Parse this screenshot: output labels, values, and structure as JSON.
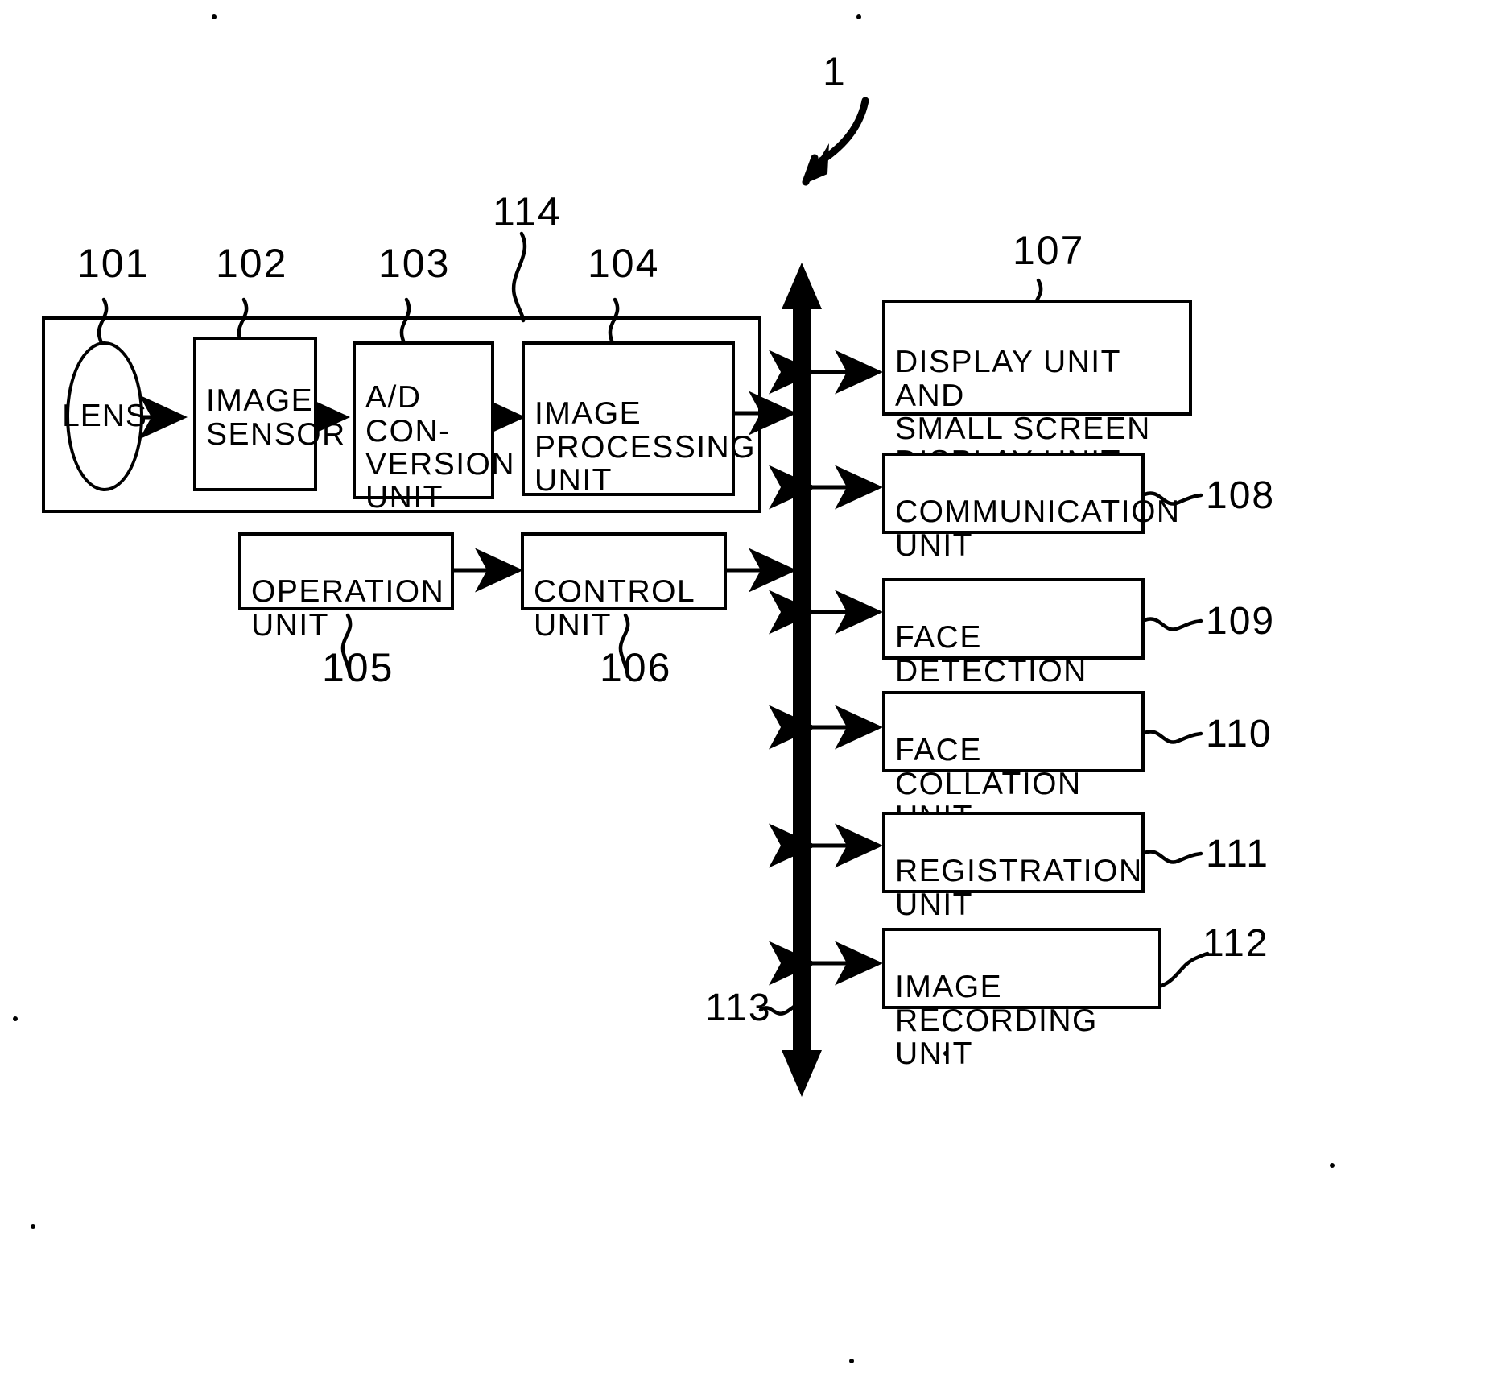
{
  "figure": {
    "overall_ref": "1",
    "blocks": [
      {
        "id": "lens",
        "ref": "101",
        "label": "LENS"
      },
      {
        "id": "image-sensor",
        "ref": "102",
        "label": "IMAGE\nSENSOR"
      },
      {
        "id": "ad-conversion",
        "ref": "103",
        "label": "A/D\nCON-\nVERSION\nUNIT"
      },
      {
        "id": "image-processing",
        "ref": "104",
        "label": "IMAGE\nPROCESSING\nUNIT"
      },
      {
        "id": "operation",
        "ref": "105",
        "label": "OPERATION\nUNIT"
      },
      {
        "id": "control",
        "ref": "106",
        "label": "CONTROL\nUNIT"
      },
      {
        "id": "display",
        "ref": "107",
        "label": "DISPLAY UNIT AND\nSMALL SCREEN\nDISPLAY UNIT"
      },
      {
        "id": "communication",
        "ref": "108",
        "label": "COMMUNICATION\nUNIT"
      },
      {
        "id": "face-detection",
        "ref": "109",
        "label": "FACE DETECTION\nUNIT"
      },
      {
        "id": "face-collation",
        "ref": "110",
        "label": "FACE COLLATION\nUNIT"
      },
      {
        "id": "registration",
        "ref": "111",
        "label": "REGISTRATION\nUNIT"
      },
      {
        "id": "image-recording",
        "ref": "112",
        "label": "IMAGE RECORDING\nUNIT"
      }
    ],
    "bus": {
      "ref": "113",
      "name": "system-bus"
    },
    "imaging_frame": {
      "ref": "114",
      "name": "imaging-unit-enclosure"
    }
  },
  "refs": {
    "r1": "1",
    "r101": "101",
    "r102": "102",
    "r103": "103",
    "r104": "104",
    "r105": "105",
    "r106": "106",
    "r107": "107",
    "r108": "108",
    "r109": "109",
    "r110": "110",
    "r111": "111",
    "r112": "112",
    "r113": "113",
    "r114": "114"
  },
  "labels": {
    "lens": "LENS",
    "image_sensor": "IMAGE\nSENSOR",
    "ad_conversion": "A/D\nCON-\nVERSION\nUNIT",
    "image_processing": "IMAGE\nPROCESSING\nUNIT",
    "operation_unit": "OPERATION\nUNIT",
    "control_unit": "CONTROL\nUNIT",
    "display_unit": "DISPLAY UNIT AND\nSMALL SCREEN\nDISPLAY UNIT",
    "communication_unit": "COMMUNICATION\nUNIT",
    "face_detection_unit": "FACE DETECTION\nUNIT",
    "face_collation_unit": "FACE COLLATION\nUNIT",
    "registration_unit": "REGISTRATION\nUNIT",
    "image_recording_unit": "IMAGE RECORDING\nUNIT"
  },
  "colors": {
    "ink": "#000000",
    "paper": "#ffffff"
  }
}
